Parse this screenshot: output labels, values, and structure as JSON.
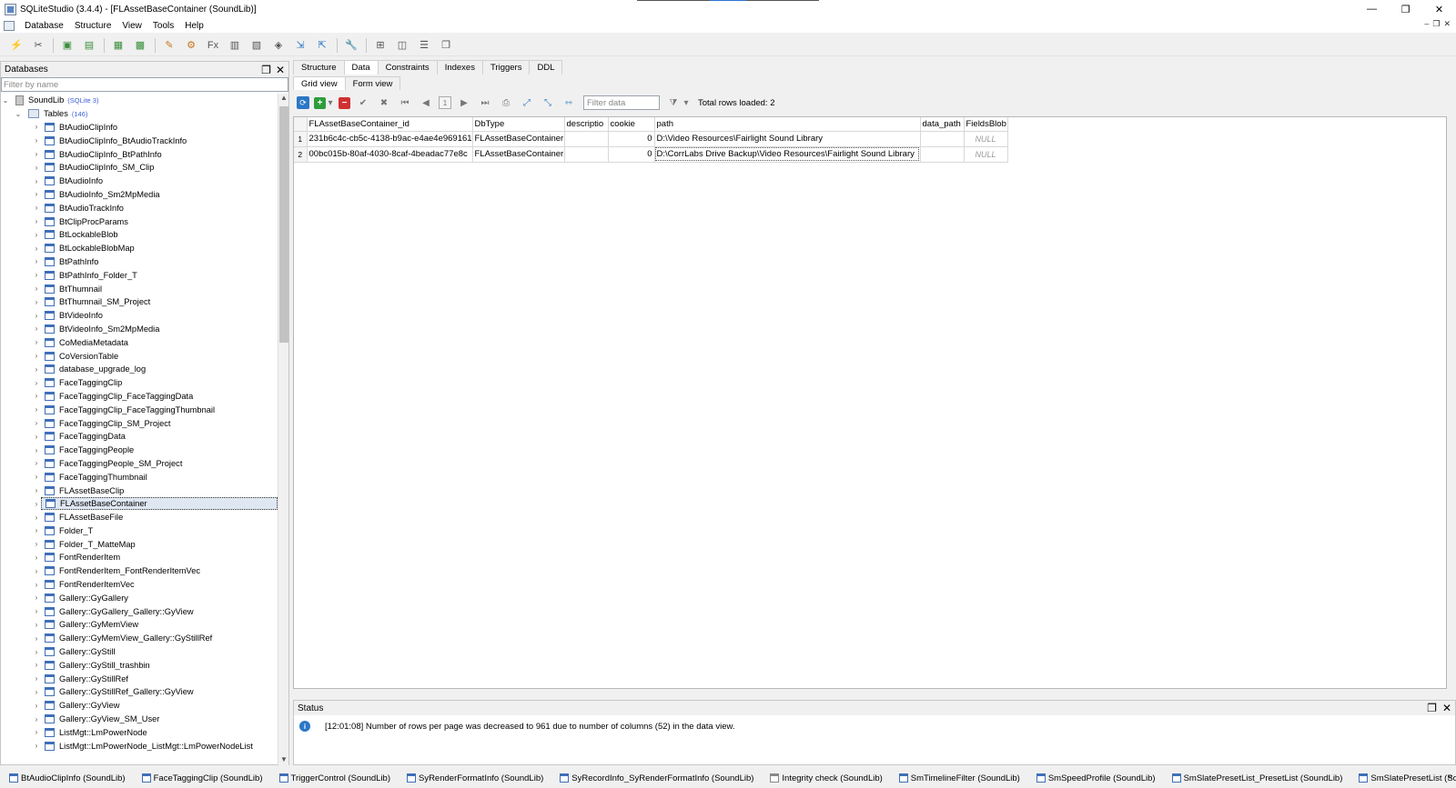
{
  "window": {
    "title": "SQLiteStudio (3.4.4) - [FLAssetBaseContainer (SoundLib)]",
    "controls": {
      "minimize": "—",
      "restore": "❐",
      "close": "✕"
    },
    "mdi_controls": [
      "–",
      "❐",
      "✕"
    ]
  },
  "menu": {
    "items": [
      "Database",
      "Structure",
      "View",
      "Tools",
      "Help"
    ]
  },
  "toolbar": {
    "icons": [
      "connect-icon",
      "disconnect-icon",
      "add-database-icon",
      "remove-database-icon",
      "new-table-icon",
      "edit-table-icon",
      "new-view-icon",
      "new-trigger-icon",
      "function-editor-icon",
      "collation-editor-icon",
      "extension-manager-icon",
      "sql-editor-icon",
      "import-icon",
      "export-icon",
      "config-icon",
      "tile-icon",
      "tile-horizontal-icon",
      "tile-vertical-icon",
      "cascade-icon"
    ],
    "function_label": "Fx"
  },
  "databases_panel": {
    "title": "Databases",
    "filter_placeholder": "Filter by name",
    "db_name": "SoundLib",
    "db_tag": "(SQLite 3)",
    "tables_label": "Tables",
    "tables_count": "(146)",
    "tables": [
      "BtAudioClipInfo",
      "BtAudioClipInfo_BtAudioTrackInfo",
      "BtAudioClipInfo_BtPathInfo",
      "BtAudioClipInfo_SM_Clip",
      "BtAudioInfo",
      "BtAudioInfo_Sm2MpMedia",
      "BtAudioTrackInfo",
      "BtClipProcParams",
      "BtLockableBlob",
      "BtLockableBlobMap",
      "BtPathInfo",
      "BtPathInfo_Folder_T",
      "BtThumnail",
      "BtThumnail_SM_Project",
      "BtVideoInfo",
      "BtVideoInfo_Sm2MpMedia",
      "CoMediaMetadata",
      "CoVersionTable",
      "database_upgrade_log",
      "FaceTaggingClip",
      "FaceTaggingClip_FaceTaggingData",
      "FaceTaggingClip_FaceTaggingThumbnail",
      "FaceTaggingClip_SM_Project",
      "FaceTaggingData",
      "FaceTaggingPeople",
      "FaceTaggingPeople_SM_Project",
      "FaceTaggingThumbnail",
      "FLAssetBaseClip",
      "FLAssetBaseContainer",
      "FLAssetBaseFile",
      "Folder_T",
      "Folder_T_MatteMap",
      "FontRenderItem",
      "FontRenderItem_FontRenderItemVec",
      "FontRenderItemVec",
      "Gallery::GyGallery",
      "Gallery::GyGallery_Gallery::GyView",
      "Gallery::GyMemView",
      "Gallery::GyMemView_Gallery::GyStillRef",
      "Gallery::GyStill",
      "Gallery::GyStill_trashbin",
      "Gallery::GyStillRef",
      "Gallery::GyStillRef_Gallery::GyView",
      "Gallery::GyView",
      "Gallery::GyView_SM_User",
      "ListMgt::LmPowerNode",
      "ListMgt::LmPowerNode_ListMgt::LmPowerNodeList"
    ],
    "selected_index": 28
  },
  "tabs": {
    "items": [
      "Structure",
      "Data",
      "Constraints",
      "Indexes",
      "Triggers",
      "DDL"
    ],
    "active": 1,
    "subtabs": [
      "Grid view",
      "Form view"
    ],
    "active_subtab": 0
  },
  "grid_toolbar": {
    "page_number": "1",
    "filter_placeholder": "Filter data",
    "total_rows_label": "Total rows loaded: 2"
  },
  "grid": {
    "columns": [
      "FLAssetBaseContainer_id",
      "DbType",
      "descriptio",
      "cookie",
      "path",
      "data_path",
      "FieldsBlob"
    ],
    "rows": [
      {
        "num": "1",
        "cells": [
          "231b6c4c-cb5c-4138-b9ac-e4ae4e969161",
          "FLAssetBaseContainer",
          "",
          "0",
          "D:\\Video Resources\\Fairlight Sound Library",
          "",
          "NULL"
        ]
      },
      {
        "num": "2",
        "cells": [
          "00bc015b-80af-4030-8caf-4beadac77e8c",
          "FLAssetBaseContainer",
          "",
          "0",
          "D:\\CorrLabs Drive Backup\\Video Resources\\Fairlight Sound Library",
          "",
          "NULL"
        ]
      }
    ]
  },
  "status": {
    "title": "Status",
    "message": "[12:01:08]  Number of rows per page was decreased to 961 due to number of columns (52) in the data view."
  },
  "open_windows": [
    "BtAudioClipInfo (SoundLib)",
    "FaceTaggingClip (SoundLib)",
    "TriggerControl (SoundLib)",
    "SyRenderFormatInfo (SoundLib)",
    "SyRecordInfo_SyRenderFormatInfo (SoundLib)",
    "Integrity check (SoundLib)",
    "SmTimelineFilter (SoundLib)",
    "SmSpeedProfile (SoundLib)",
    "SmSlatePresetList_PresetList (SoundLib)",
    "SmSlatePresetList (SoundLib)"
  ],
  "colors": {
    "accent": "#2b77c6",
    "selection": "#dfe7f2",
    "add": "#2e9d3c",
    "delete": "#d23030"
  }
}
